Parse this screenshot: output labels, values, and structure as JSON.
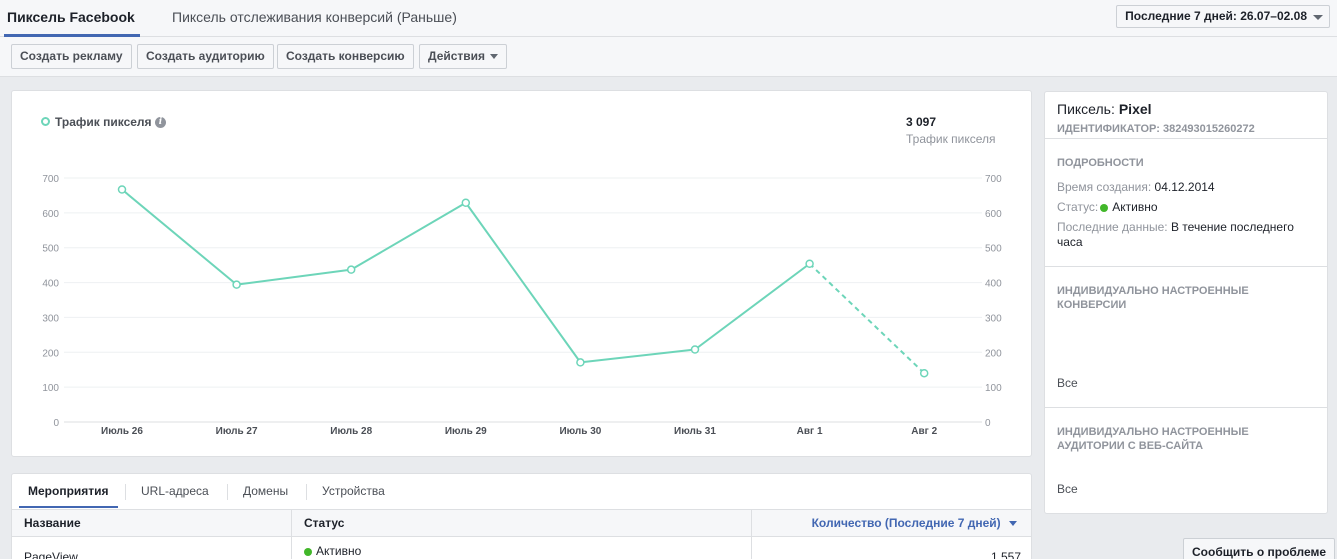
{
  "header": {
    "tab_active": "Пиксель Facebook",
    "tab_inactive": "Пиксель отслеживания конверсий (Раньше)",
    "date_range": "Последние 7 дней: 26.07–02.08"
  },
  "toolbar": {
    "create_ad": "Создать рекламу",
    "create_audience": "Создать аудиторию",
    "create_conversion": "Создать конверсию",
    "actions": "Действия"
  },
  "chart_panel": {
    "legend_label": "Трафик пикселя",
    "total_value": "3 097",
    "total_label": "Трафик пикселя"
  },
  "chart_data": {
    "type": "line",
    "categories": [
      "Июль 26",
      "Июль 27",
      "Июль 28",
      "Июль 29",
      "Июль 30",
      "Июль 31",
      "Авг 1",
      "Авг 2"
    ],
    "series": [
      {
        "name": "Трафик пикселя",
        "values": [
          667,
          394,
          437,
          629,
          171,
          208,
          454,
          140
        ]
      }
    ],
    "yticks": [
      0,
      100,
      200,
      300,
      400,
      500,
      600,
      700
    ],
    "ylim": [
      0,
      700
    ],
    "grid": true,
    "dashed_last_segment": true,
    "line_color": "#6dd5b9"
  },
  "sidebar": {
    "pixel_label": "Пиксель:",
    "pixel_name": "Pixel",
    "pixel_id": "ИДЕНТИФИКАТОР: 382493015260272",
    "details_header": "ПОДРОБНОСТИ",
    "created_label": "Время создания:",
    "created_value": "04.12.2014",
    "status_label": "Статус:",
    "status_value": "Активно",
    "last_data_label": "Последние данные:",
    "last_data_value_1": "В течение последнего",
    "last_data_value_2": "часа",
    "custom_conv_header_1": "ИНДИВИДУАЛЬНО НАСТРОЕННЫЕ",
    "custom_conv_header_2": "КОНВЕРСИИ",
    "custom_conv_link": "Все",
    "custom_aud_header_1": "ИНДИВИДУАЛЬНО НАСТРОЕННЫЕ",
    "custom_aud_header_2": "АУДИТОРИИ С ВЕБ-САЙТА",
    "custom_aud_link": "Все"
  },
  "table": {
    "tabs": [
      "Мероприятия",
      "URL-адреса",
      "Домены",
      "Устройства"
    ],
    "col_name": "Название",
    "col_status": "Статус",
    "col_count": "Количество (Последние 7 дней)",
    "rows": [
      {
        "name": "PageView",
        "status": "Активно",
        "count": "1 557"
      }
    ]
  },
  "footer": {
    "report_button": "Сообщить о проблеме"
  },
  "colors": {
    "accent": "#4267b2",
    "line": "#6dd5b9",
    "active_status": "#42b72a"
  }
}
